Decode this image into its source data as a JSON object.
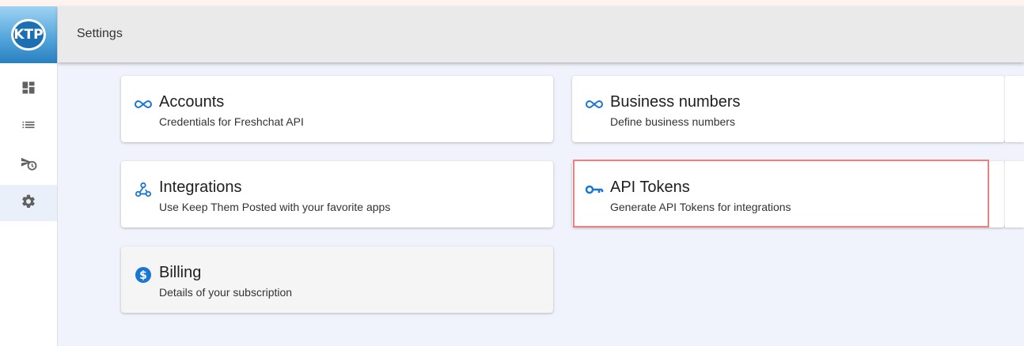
{
  "app": {
    "logo_text": "KTP"
  },
  "header": {
    "title": "Settings"
  },
  "sidebar": {
    "items": [
      {
        "name": "dashboard",
        "icon": "dashboard-icon"
      },
      {
        "name": "list",
        "icon": "list-icon"
      },
      {
        "name": "scheduled-send",
        "icon": "scheduled-send-icon"
      },
      {
        "name": "settings",
        "icon": "gear-icon",
        "active": true
      }
    ]
  },
  "cards": {
    "accounts": {
      "title": "Accounts",
      "subtitle": "Credentials for Freshchat API",
      "icon": "infinity-icon"
    },
    "business_numbers": {
      "title": "Business numbers",
      "subtitle": "Define business numbers",
      "icon": "infinity-icon"
    },
    "integrations": {
      "title": "Integrations",
      "subtitle": "Use Keep Them Posted with your favorite apps",
      "icon": "webhook-icon"
    },
    "api_tokens": {
      "title": "API Tokens",
      "subtitle": "Generate API Tokens for integrations",
      "icon": "key-icon"
    },
    "billing": {
      "title": "Billing",
      "subtitle": "Details of your subscription",
      "icon": "dollar-icon"
    }
  },
  "colors": {
    "accent": "#1976d2",
    "highlight": "#f08080",
    "sidebar_icon": "#616161"
  }
}
